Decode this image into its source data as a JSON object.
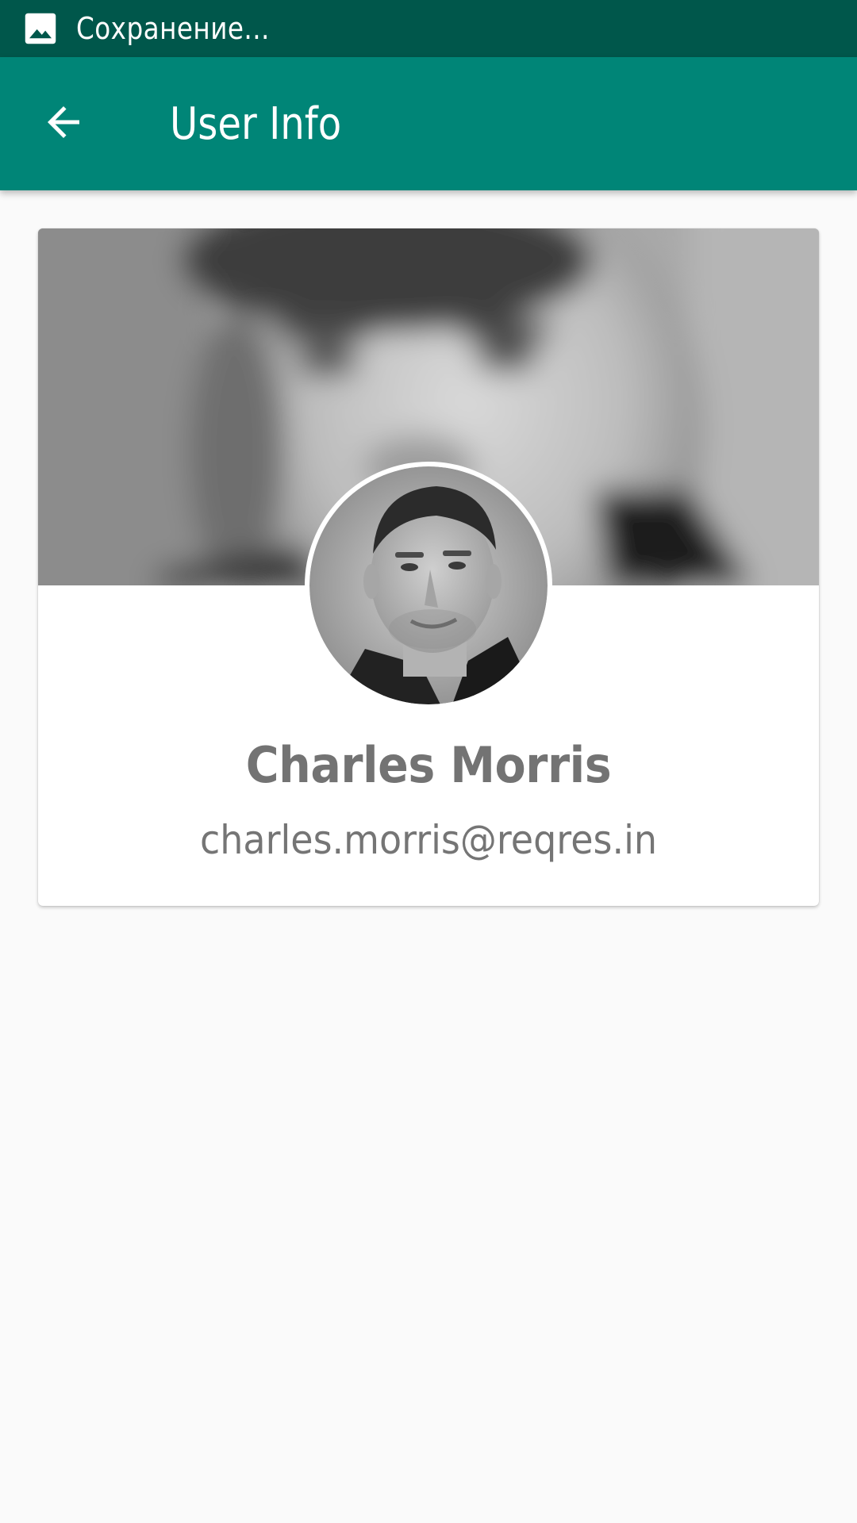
{
  "status_bar": {
    "icon": "image-icon",
    "text": "Сохранение...",
    "background": "#00574b"
  },
  "app_bar": {
    "back_icon": "arrow-back-icon",
    "title": "User Info",
    "background": "#008577"
  },
  "user_card": {
    "cover_image": "blurred-portrait-photo",
    "avatar_image": "user-avatar-photo",
    "name": "Charles Morris",
    "email": "charles.morris@reqres.in"
  },
  "colors": {
    "page_background": "#fafafa",
    "card_background": "#ffffff",
    "name_text": "#737373",
    "email_text": "#757575"
  }
}
